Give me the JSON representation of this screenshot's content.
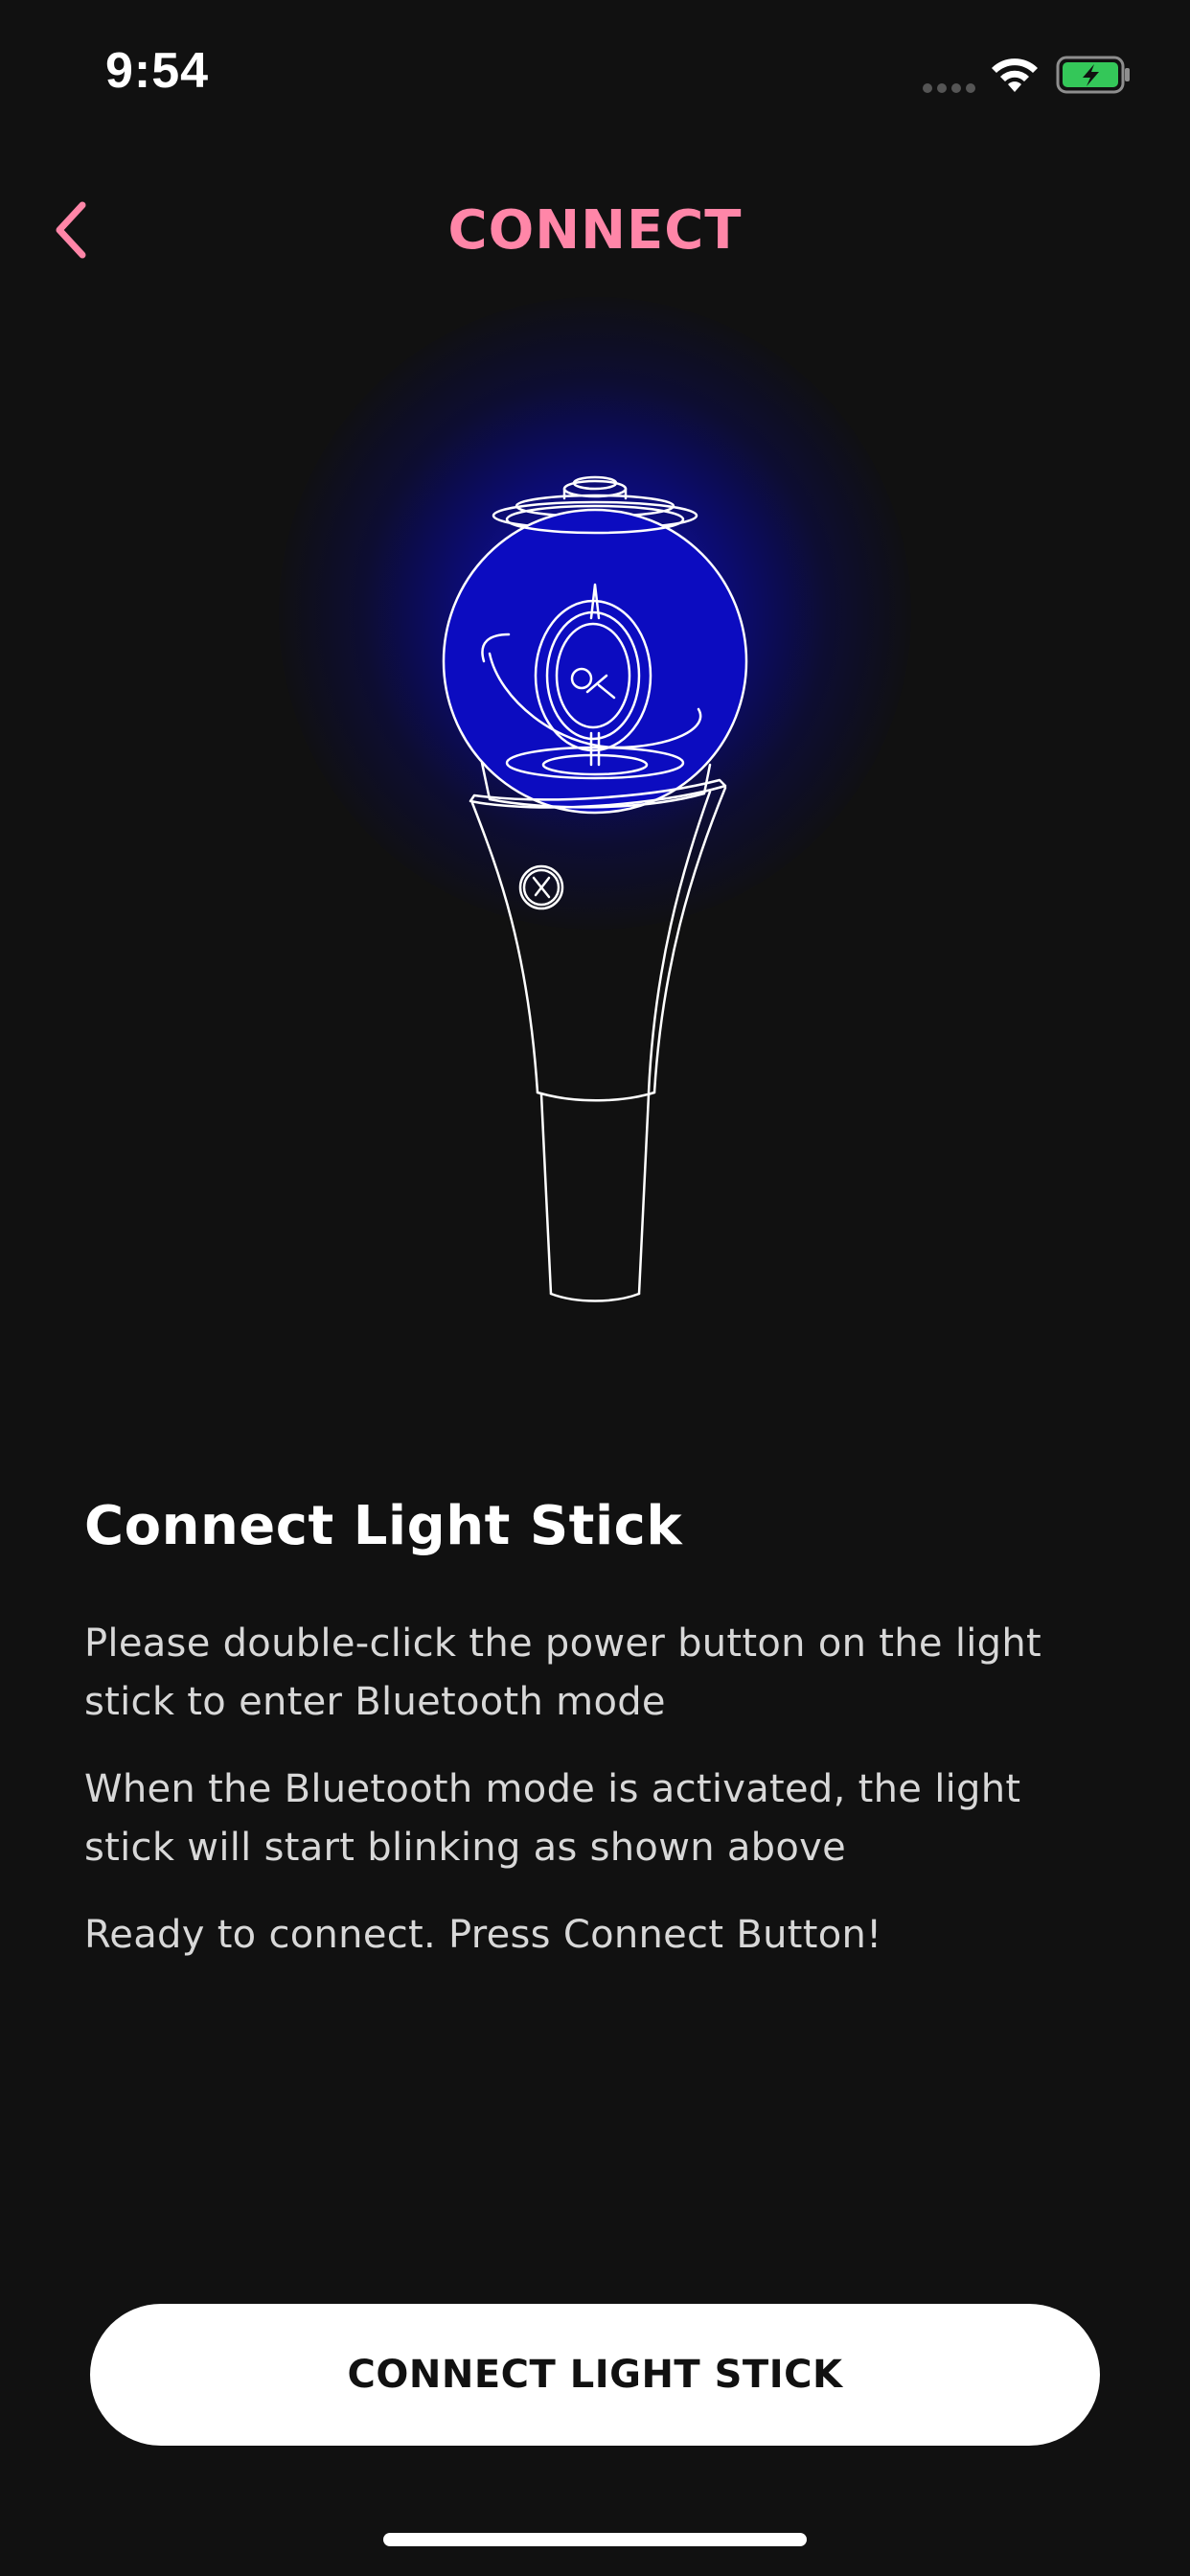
{
  "status_bar": {
    "time": "9:54",
    "icons": [
      "signal-icon",
      "wifi-icon",
      "battery-charging-icon"
    ],
    "battery_color": "#34c759"
  },
  "header": {
    "title": "CONNECT",
    "back_icon": "chevron-left-icon",
    "accent_color": "#ff86a8"
  },
  "hero": {
    "illustration": "light-stick-illustration",
    "glow_color": "#1010c8"
  },
  "content": {
    "title": "Connect Light Stick",
    "instructions": [
      "Please double-click the power button on the light stick to enter Bluetooth mode",
      "When the Bluetooth mode is activated, the light stick will start blinking as shown above",
      "Ready to connect. Press Connect Button!"
    ]
  },
  "actions": {
    "connect_label": "CONNECT LIGHT STICK"
  }
}
